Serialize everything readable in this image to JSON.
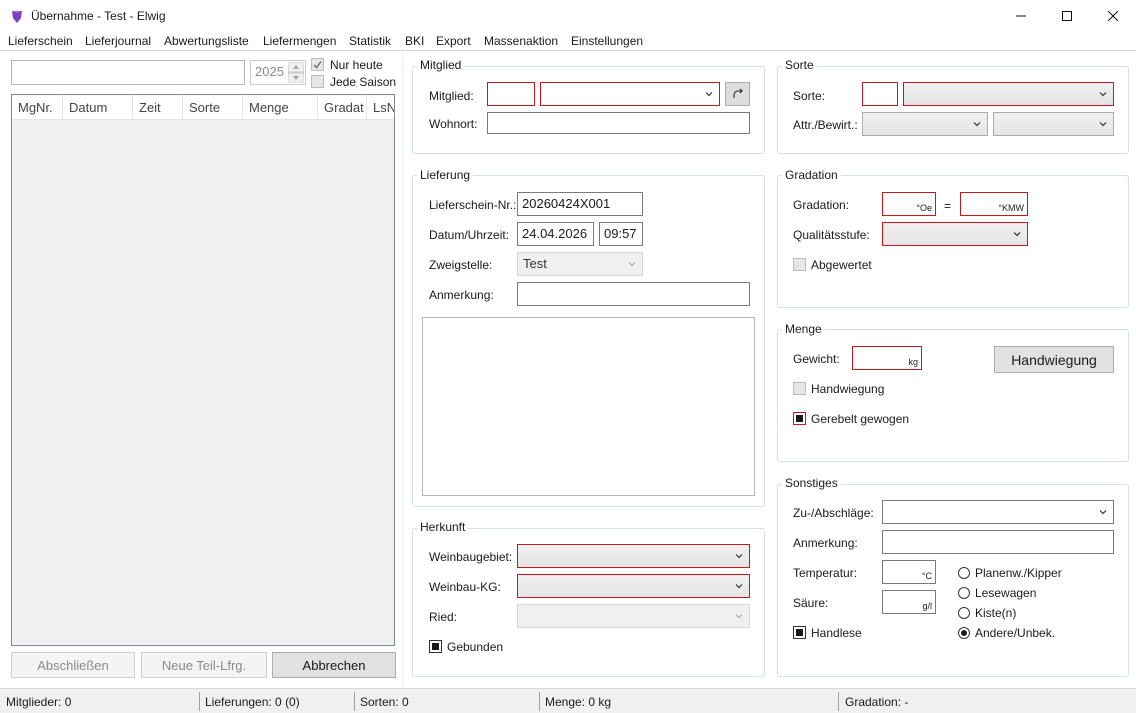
{
  "window": {
    "title": "Übernahme - Test - Elwig"
  },
  "menu": [
    "Lieferschein",
    "Lieferjournal",
    "Abwertungsliste",
    "Liefermengen",
    "Statistik",
    "BKI",
    "Export",
    "Massenaktion",
    "Einstellungen"
  ],
  "left": {
    "search_value": "",
    "year": "2025",
    "nur_heute": "Nur heute",
    "jede_saison": "Jede Saison",
    "columns": [
      "MgNr.",
      "Datum",
      "Zeit",
      "Sorte",
      "Menge",
      "Gradat",
      "LsN"
    ],
    "btn_abschliessen": "Abschließen",
    "btn_neue_teil": "Neue Teil-Lfrg.",
    "btn_abbrechen": "Abbrechen"
  },
  "mitglied": {
    "title": "Mitglied",
    "label_mitglied": "Mitglied:",
    "label_wohnort": "Wohnort:"
  },
  "lieferung": {
    "title": "Lieferung",
    "label_lsnr": "Lieferschein-Nr.:",
    "lsnr": "20260424X001",
    "label_datum": "Datum/Uhrzeit:",
    "datum": "24.04.2026",
    "uhrzeit": "09:57",
    "label_zweigstelle": "Zweigstelle:",
    "zweigstelle": "Test",
    "label_anmerkung": "Anmerkung:"
  },
  "herkunft": {
    "title": "Herkunft",
    "label_weinbaugebiet": "Weinbaugebiet:",
    "label_kg": "Weinbau-KG:",
    "label_ried": "Ried:",
    "gebunden": "Gebunden"
  },
  "sorte": {
    "title": "Sorte",
    "label_sorte": "Sorte:",
    "label_attr": "Attr./Bewirt.:"
  },
  "gradation": {
    "title": "Gradation",
    "label_gradation": "Gradation:",
    "unit_oe": "°Oe",
    "equals": "=",
    "unit_kmw": "°KMW",
    "label_qualitaet": "Qualitätsstufe:",
    "abgewertet": "Abgewertet"
  },
  "menge": {
    "title": "Menge",
    "label_gewicht": "Gewicht:",
    "unit_kg": "kg",
    "btn_handwiegung": "Handwiegung",
    "chk_handwiegung": "Handwiegung",
    "chk_gerebelt": "Gerebelt gewogen"
  },
  "sonstiges": {
    "title": "Sonstiges",
    "label_zuab": "Zu-/Abschläge:",
    "label_anmerkung": "Anmerkung:",
    "label_temperatur": "Temperatur:",
    "unit_c": "°C",
    "label_saeure": "Säure:",
    "unit_gl": "g/l",
    "handlese": "Handlese",
    "radio": [
      "Planenw./Kipper",
      "Lesewagen",
      "Kiste(n)",
      "Andere/Unbek."
    ],
    "radio_selected": 3
  },
  "status": {
    "mitglieder": "Mitglieder: 0",
    "lieferungen": "Lieferungen: 0 (0)",
    "sorten": "Sorten: 0",
    "menge": "Menge: 0 kg",
    "gradation": "Gradation: -"
  }
}
